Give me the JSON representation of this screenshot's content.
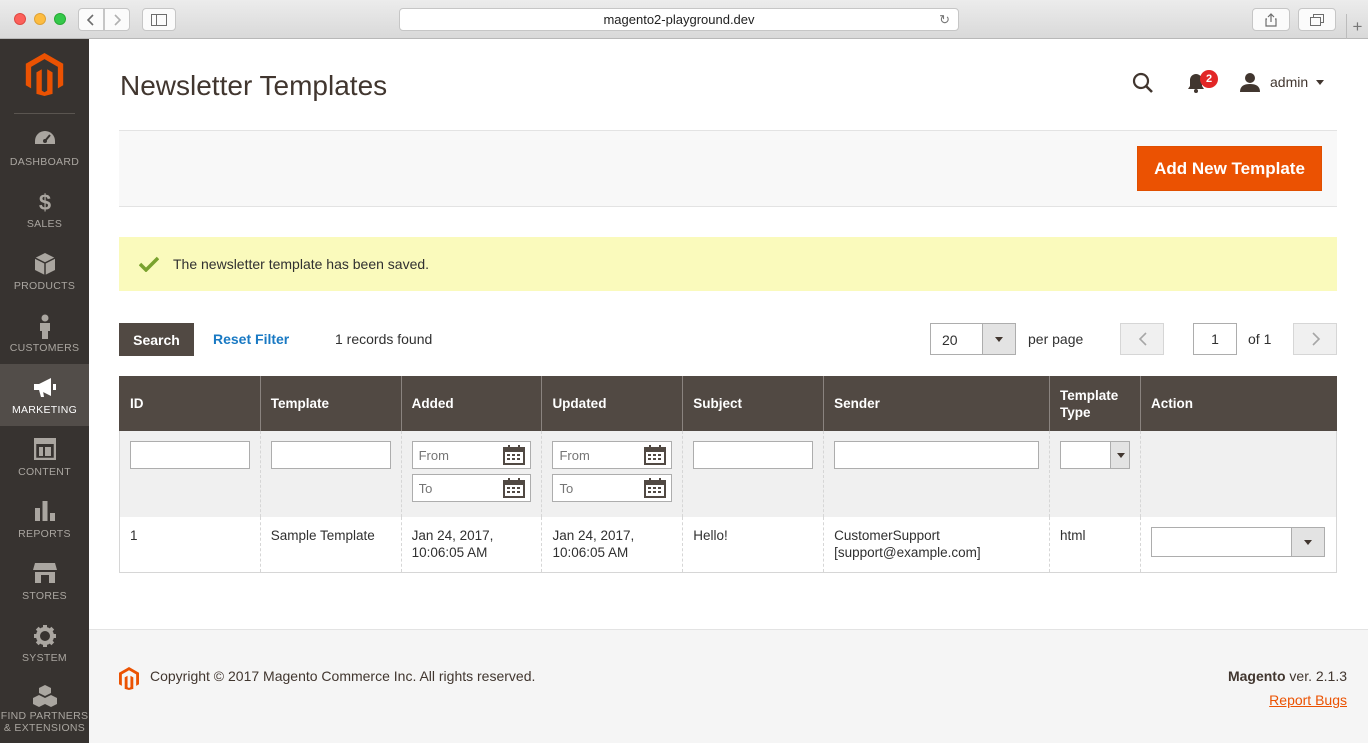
{
  "browser": {
    "url": "magento2-playground.dev"
  },
  "sidebar": {
    "items": [
      {
        "label": "DASHBOARD"
      },
      {
        "label": "SALES"
      },
      {
        "label": "PRODUCTS"
      },
      {
        "label": "CUSTOMERS"
      },
      {
        "label": "MARKETING"
      },
      {
        "label": "CONTENT"
      },
      {
        "label": "REPORTS"
      },
      {
        "label": "STORES"
      },
      {
        "label": "SYSTEM"
      },
      {
        "label": "FIND PARTNERS",
        "label2": "& EXTENSIONS"
      }
    ]
  },
  "header": {
    "title": "Newsletter Templates",
    "notifications_count": "2",
    "user": "admin"
  },
  "actions": {
    "add_new": "Add New Template"
  },
  "message": {
    "text": "The newsletter template has been saved."
  },
  "toolbar": {
    "search": "Search",
    "reset": "Reset Filter",
    "records": "1 records found",
    "per_page_value": "20",
    "per_page_label": "per page",
    "page": "1",
    "of_pages": "of 1"
  },
  "grid": {
    "columns": [
      "ID",
      "Template",
      "Added",
      "Updated",
      "Subject",
      "Sender",
      "Template Type",
      "Action"
    ],
    "filters": {
      "from_placeholder": "From",
      "to_placeholder": "To"
    },
    "rows": [
      {
        "id": "1",
        "template": "Sample Template",
        "added_1": "Jan 24, 2017,",
        "added_2": "10:06:05 AM",
        "updated_1": "Jan 24, 2017,",
        "updated_2": "10:06:05 AM",
        "subject": "Hello!",
        "sender_1": "CustomerSupport",
        "sender_2": "[support@example.com]",
        "type": "html"
      }
    ]
  },
  "footer": {
    "copyright": "Copyright © 2017 Magento Commerce Inc. All rights reserved.",
    "brand": "Magento",
    "version": " ver. 2.1.3",
    "report": "Report Bugs"
  }
}
